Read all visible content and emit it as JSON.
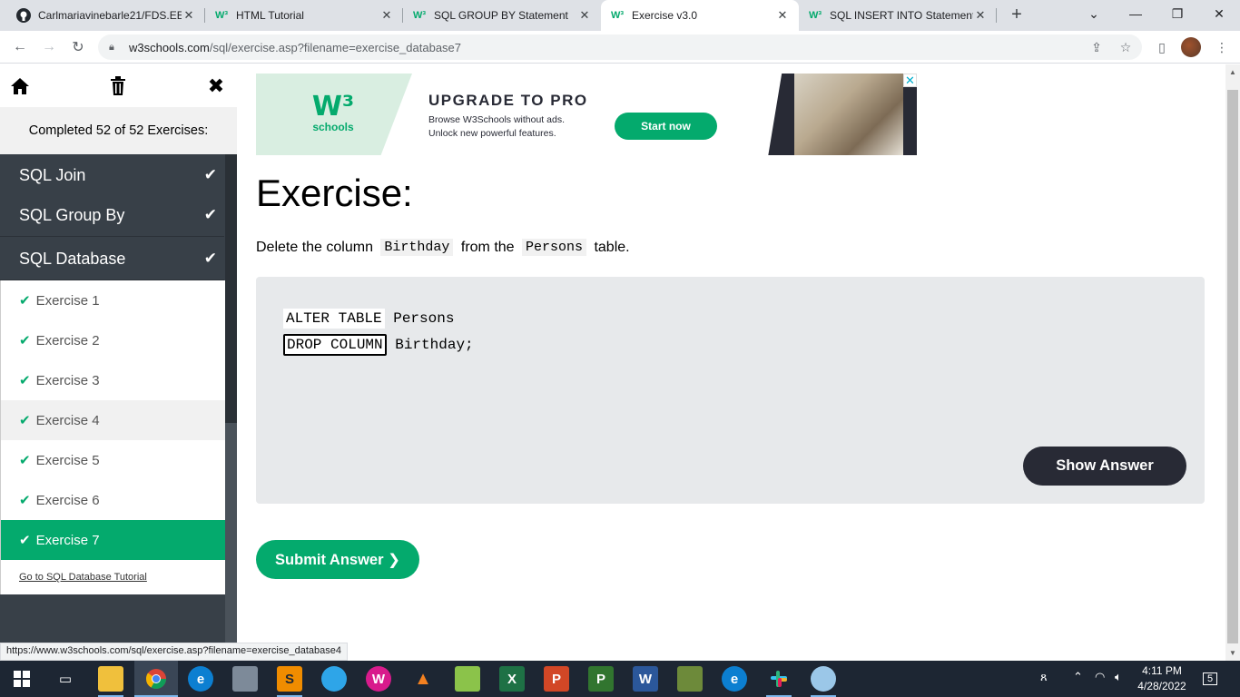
{
  "browser": {
    "tabs": [
      {
        "title": "Carlmariavinebarle21/FDS.EE",
        "icon": "github-icon"
      },
      {
        "title": "HTML Tutorial",
        "icon": "w3schools-icon"
      },
      {
        "title": "SQL GROUP BY Statement",
        "icon": "w3schools-icon"
      },
      {
        "title": "Exercise v3.0",
        "icon": "w3schools-icon",
        "active": true
      },
      {
        "title": "SQL INSERT INTO Statement",
        "icon": "w3schools-icon"
      }
    ],
    "url_host": "w3schools.com",
    "url_path": "/sql/exercise.asp?filename=exercise_database7",
    "status_url": "https://www.w3schools.com/sql/exercise.asp?filename=exercise_database4"
  },
  "sidebar": {
    "completed_text": "Completed 52 of 52 Exercises:",
    "categories": [
      {
        "label": "SQL Join"
      },
      {
        "label": "SQL Group By"
      },
      {
        "label": "SQL Database"
      }
    ],
    "exercises": [
      {
        "label": "Exercise 1"
      },
      {
        "label": "Exercise 2"
      },
      {
        "label": "Exercise 3"
      },
      {
        "label": "Exercise 4"
      },
      {
        "label": "Exercise 5"
      },
      {
        "label": "Exercise 6"
      },
      {
        "label": "Exercise 7"
      }
    ],
    "tutorial_link": "Go to SQL Database Tutorial"
  },
  "ad": {
    "logo_mark": "W³",
    "logo_text": "schools",
    "title": "UPGRADE TO PRO",
    "line1": "Browse W3Schools without ads.",
    "line2": "Unlock new powerful features.",
    "button": "Start now"
  },
  "exercise": {
    "title": "Exercise:",
    "instr_pre": "Delete the column ",
    "instr_code1": "Birthday",
    "instr_mid": " from the ",
    "instr_code2": "Persons",
    "instr_post": " table.",
    "line1_kw": "ALTER TABLE",
    "line1_rest": " Persons",
    "line2_input": "DROP COLUMN",
    "line2_rest": " Birthday;",
    "show_answer": "Show Answer",
    "submit": "Submit Answer ❯"
  },
  "taskbar": {
    "time": "4:11 PM",
    "date": "4/28/2022",
    "notifications": "5"
  },
  "colors": {
    "accent": "#04aa6d",
    "sidebar_dark": "#384048",
    "button_dark": "#282a35"
  }
}
